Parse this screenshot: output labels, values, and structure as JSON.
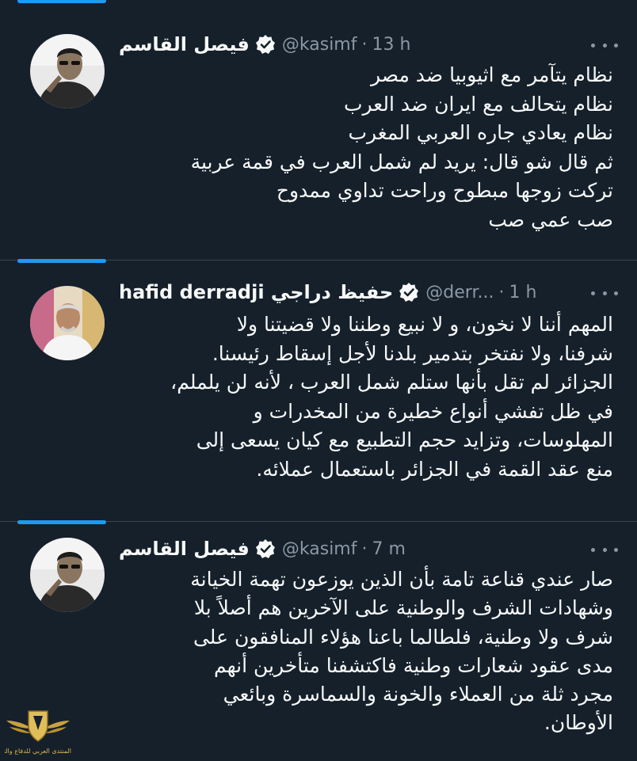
{
  "colors": {
    "background": "#15202b",
    "text": "#f7f9f9",
    "muted": "#8b98a5",
    "accent": "#1d9bf0",
    "divider": "#38444d"
  },
  "tweets": [
    {
      "name": "فيصل القاسم",
      "handle": "@kasimf",
      "separator": "·",
      "time": "13 h",
      "verified_icon": "verified-badge-icon",
      "lines": [
        "نظام  يتآمر مع اثيوبيا ضد مصر",
        "نظام يتحالف مع ايران ضد العرب",
        "نظام يعادي جاره العربي المغرب",
        "ثم قال شو قال: يريد لم شمل العرب في قمة عربية",
        "تركت زوجها مبطوح وراحت تداوي ممدوح",
        "صب عمي صب"
      ]
    },
    {
      "name": "hafid derradji حفيظ دراجي",
      "handle": "@derr...",
      "separator": "·",
      "time": "1 h",
      "verified_icon": "verified-badge-icon",
      "lines": [
        "المهم أننا لا نخون، و لا نبيع وطننا ولا قضيتنا ولا",
        "شرفنا، ولا نفتخر بتدمير بلدنا لأجل إسقاط رئيسنا.",
        "الجزائر لم تقل بأنها ستلم شمل العرب ، لأنه لن يلملم،",
        "في ظل تفشي أنواع خطيرة من المخدرات و",
        "المهلوسات، وتزايد حجم التطبيع مع كيان يسعى إلى",
        "منع عقد القمة في الجزائر باستعمال عملائه."
      ]
    },
    {
      "name": "فيصل القاسم",
      "handle": "@kasimf",
      "separator": "·",
      "time": "7 m",
      "verified_icon": "verified-badge-icon",
      "lines": [
        "صار عندي قناعة تامة بأن الذين يوزعون تهمة الخيانة",
        "وشهادات الشرف والوطنية على الآخرين هم أصلاً بلا",
        "شرف ولا وطنية، فلطالما باعنا هؤلاء المنافقون على",
        "مدى عقود شعارات وطنية فاكتشفنا متأخرين أنهم",
        "مجرد ثلة من العملاء والخونة والسماسرة وبائعي",
        "الأوطان."
      ]
    }
  ],
  "watermark": {
    "caption": "المنتدى العربي للدفاع والتسليح"
  }
}
